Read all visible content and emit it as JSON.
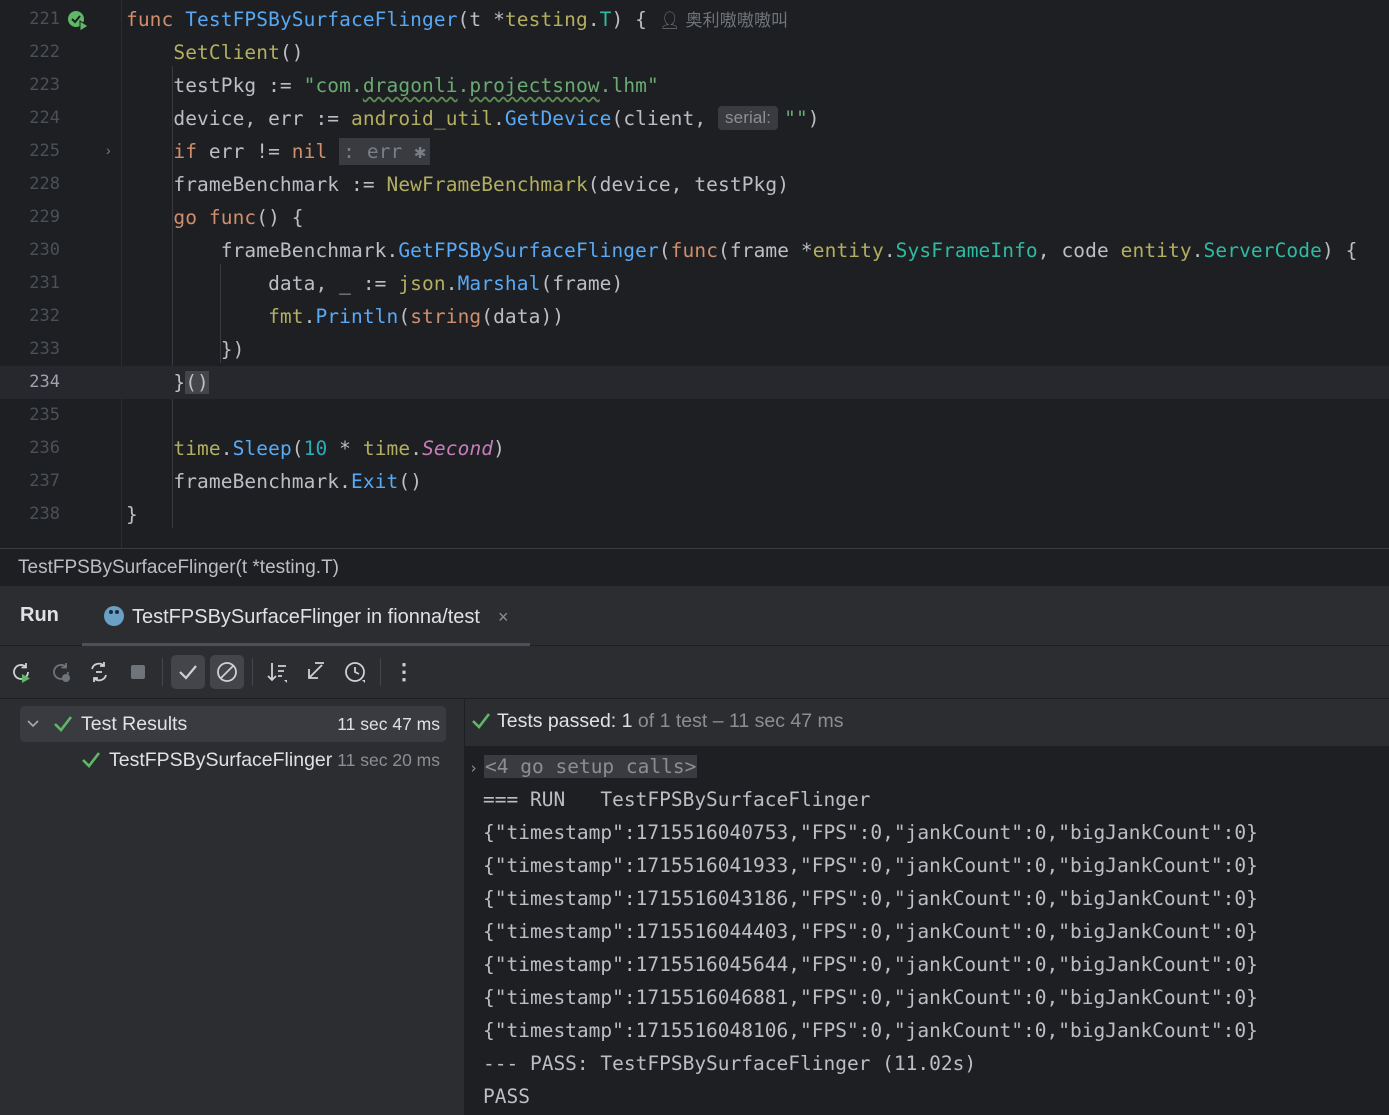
{
  "editor": {
    "author": "奥利嗷嗷嗷叫",
    "lines": [
      {
        "num": "221",
        "current": false
      },
      {
        "num": "222",
        "current": false
      },
      {
        "num": "223",
        "current": false
      },
      {
        "num": "224",
        "current": false
      },
      {
        "num": "225",
        "current": false
      },
      {
        "num": "228",
        "current": false
      },
      {
        "num": "229",
        "current": false
      },
      {
        "num": "230",
        "current": false
      },
      {
        "num": "231",
        "current": false
      },
      {
        "num": "232",
        "current": false
      },
      {
        "num": "233",
        "current": false
      },
      {
        "num": "234",
        "current": true
      },
      {
        "num": "235",
        "current": false
      },
      {
        "num": "236",
        "current": false
      },
      {
        "num": "237",
        "current": false
      },
      {
        "num": "238",
        "current": false
      }
    ],
    "code": {
      "l221_kw": "func",
      "l221_name": "TestFPSBySurfaceFlinger",
      "l221_rest": "(t *",
      "l221_pkg": "testing",
      "l221_type": "T",
      "l221_end": ") {",
      "l222": "SetClient",
      "l222_end": "()",
      "l223_var": "testPkg := ",
      "l223_str1": "\"com.",
      "l223_str2": "dragonli",
      "l223_str3": ".",
      "l223_str4": "projectsnow",
      "l223_str5": ".lhm\"",
      "l224_var": "device, err := ",
      "l224_pkg": "android_util",
      "l224_fn": "GetDevice",
      "l224_args": "(client, ",
      "l224_hint": "serial:",
      "l224_str": "\"\"",
      "l224_end": ")",
      "l225_kw": "if",
      "l225_mid": " err != ",
      "l225_nil": "nil",
      "l225_fold": ": err ✱",
      "l228_var": "frameBenchmark := ",
      "l228_fn": "NewFrameBenchmark",
      "l228_args": "(device, testPkg)",
      "l229_kw1": "go",
      "l229_kw2": "func",
      "l229_end": "() {",
      "l230_obj": "frameBenchmark.",
      "l230_fn": "GetFPSBySurfaceFlinger",
      "l230_p1": "(",
      "l230_kw": "func",
      "l230_p2": "(frame *",
      "l230_pkg1": "entity",
      "l230_type1": "SysFrameInfo",
      "l230_p3": ", code ",
      "l230_pkg2": "entity",
      "l230_type2": "ServerCode",
      "l230_end": ") {",
      "l231_var": "data, _ := ",
      "l231_pkg": "json",
      "l231_fn": "Marshal",
      "l231_args": "(frame)",
      "l232_pkg": "fmt",
      "l232_fn": "Println",
      "l232_p1": "(",
      "l232_kw": "string",
      "l232_args": "(data))",
      "l233": "})",
      "l234_brace": "}",
      "l234_parens": "()",
      "l236_pkg1": "time",
      "l236_fn": "Sleep",
      "l236_p1": "(",
      "l236_num": "10",
      "l236_mid": " * ",
      "l236_pkg2": "time",
      "l236_const": "Second",
      "l236_end": ")",
      "l237_obj": "frameBenchmark.",
      "l237_fn": "Exit",
      "l237_end": "()",
      "l238": "}"
    }
  },
  "breadcrumb": "TestFPSBySurfaceFlinger(t *testing.T)",
  "run_window": {
    "title": "Run",
    "tab_label": "TestFPSBySurfaceFlinger in fionna/test",
    "close_glyph": "×"
  },
  "toolbar": {
    "more_glyph": "⋮"
  },
  "test_tree": {
    "root_label": "Test Results",
    "root_time": "11 sec 47 ms",
    "child_label": "TestFPSBySurfaceFlinger",
    "child_time": "11 sec 20 ms"
  },
  "console": {
    "status_prefix": "Tests passed: ",
    "status_count": "1",
    "status_rest": " of 1 test – 11 sec 47 ms",
    "setup_calls": "<4 go setup calls>",
    "lines": [
      "=== RUN   TestFPSBySurfaceFlinger",
      "{\"timestamp\":1715516040753,\"FPS\":0,\"jankCount\":0,\"bigJankCount\":0}",
      "{\"timestamp\":1715516041933,\"FPS\":0,\"jankCount\":0,\"bigJankCount\":0}",
      "{\"timestamp\":1715516043186,\"FPS\":0,\"jankCount\":0,\"bigJankCount\":0}",
      "{\"timestamp\":1715516044403,\"FPS\":0,\"jankCount\":0,\"bigJankCount\":0}",
      "{\"timestamp\":1715516045644,\"FPS\":0,\"jankCount\":0,\"bigJankCount\":0}",
      "{\"timestamp\":1715516046881,\"FPS\":0,\"jankCount\":0,\"bigJankCount\":0}",
      "{\"timestamp\":1715516048106,\"FPS\":0,\"jankCount\":0,\"bigJankCount\":0}",
      "--- PASS: TestFPSBySurfaceFlinger (11.02s)",
      "PASS"
    ]
  },
  "colors": {
    "pass_green": "#5fb865",
    "keyword": "#cf8e6d",
    "string": "#6aab73"
  }
}
